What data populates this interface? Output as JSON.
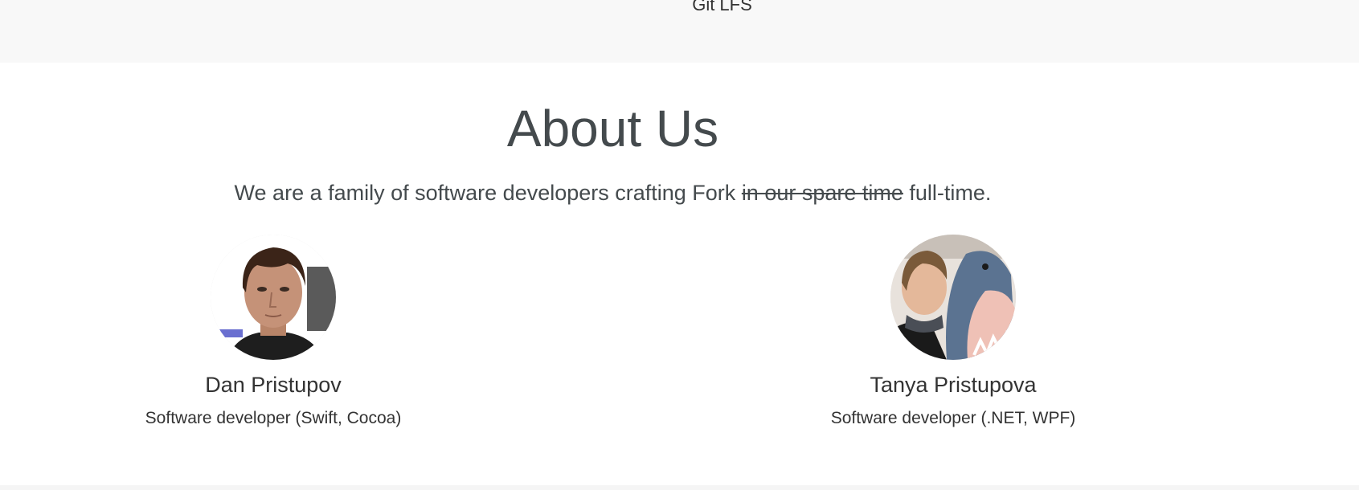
{
  "features_section": {
    "visible_item": "Git LFS"
  },
  "about": {
    "title": "About Us",
    "tagline_start": "We are a family of software developers crafting Fork ",
    "tagline_struck": "in our spare time",
    "tagline_end": " full-time."
  },
  "team": [
    {
      "name": "Dan Pristupov",
      "role": "Software developer (Swift, Cocoa)"
    },
    {
      "name": "Tanya Pristupova",
      "role": "Software developer (.NET, WPF)"
    }
  ]
}
